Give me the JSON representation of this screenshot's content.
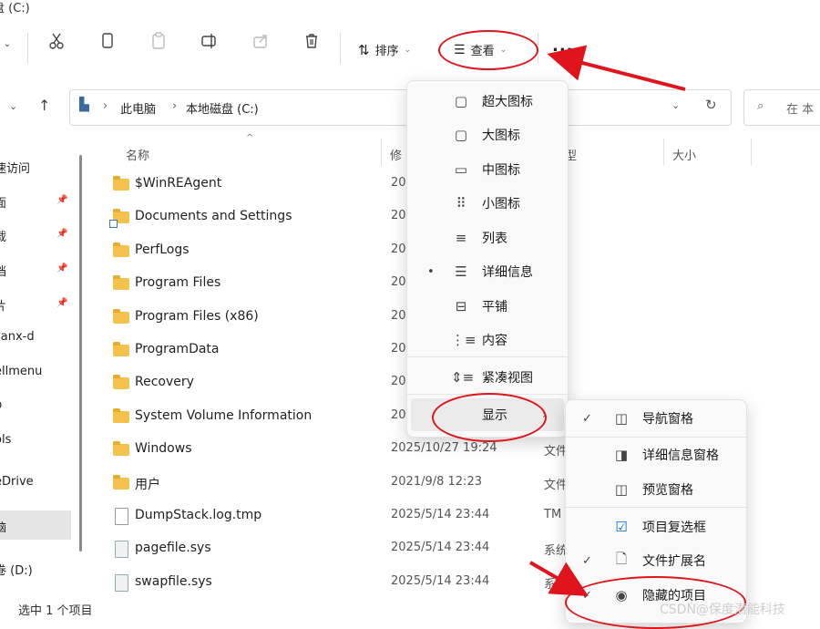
{
  "window": {
    "title": "盘 (C:)"
  },
  "toolbar": {
    "sort_label": "排序",
    "view_label": "查看",
    "more_label": "..."
  },
  "address": {
    "crumbs": [
      "此电脑",
      "本地磁盘 (C:)"
    ],
    "search_placeholder": "在 本"
  },
  "nav": {
    "items": [
      "速访问",
      "面",
      "载",
      "档",
      "片",
      "sanx-d",
      "ellmenu",
      "p",
      "ols",
      "eDrive",
      "脑",
      "卷 (D:)"
    ]
  },
  "columns": {
    "name": "名称",
    "date": "修",
    "type": "型",
    "size": "大小"
  },
  "files": [
    {
      "name": "$WinREAgent",
      "date": "20",
      "type": "夹",
      "icon": "folder"
    },
    {
      "name": "Documents and Settings",
      "date": "20",
      "type": "夹",
      "icon": "folder-shortcut"
    },
    {
      "name": "PerfLogs",
      "date": "20",
      "type": "夹",
      "icon": "folder"
    },
    {
      "name": "Program Files",
      "date": "20",
      "type": "夹",
      "icon": "folder"
    },
    {
      "name": "Program Files (x86)",
      "date": "20",
      "type": "夹",
      "icon": "folder"
    },
    {
      "name": "ProgramData",
      "date": "20",
      "type": "夹",
      "icon": "folder"
    },
    {
      "name": "Recovery",
      "date": "20",
      "type": "夹",
      "icon": "folder"
    },
    {
      "name": "System Volume Information",
      "date": "20",
      "type": "",
      "icon": "folder"
    },
    {
      "name": "Windows",
      "date": "2025/10/27 19:24",
      "type": "文件",
      "icon": "folder"
    },
    {
      "name": "用户",
      "date": "2021/9/8 12:23",
      "type": "文件",
      "icon": "folder"
    },
    {
      "name": "DumpStack.log.tmp",
      "date": "2025/5/14 23:44",
      "type": "TM",
      "icon": "file"
    },
    {
      "name": "pagefile.sys",
      "date": "2025/5/14 23:44",
      "type": "系统",
      "icon": "sys"
    },
    {
      "name": "swapfile.sys",
      "date": "2025/5/14 23:44",
      "type": "系",
      "icon": "sys"
    }
  ],
  "view_menu": {
    "items": [
      {
        "label": "超大图标",
        "icon": "monitor-icon"
      },
      {
        "label": "大图标",
        "icon": "monitor-icon"
      },
      {
        "label": "中图标",
        "icon": "monitor-small-icon"
      },
      {
        "label": "小图标",
        "icon": "grid-icon"
      },
      {
        "label": "列表",
        "icon": "list-icon"
      },
      {
        "label": "详细信息",
        "icon": "details-icon",
        "selected": true
      },
      {
        "label": "平铺",
        "icon": "tiles-icon"
      },
      {
        "label": "内容",
        "icon": "content-icon"
      },
      {
        "label": "紧凑视图",
        "icon": "compact-icon"
      },
      {
        "label": "显示",
        "icon": "",
        "submenu": true
      }
    ]
  },
  "show_submenu": {
    "items": [
      {
        "label": "导航窗格",
        "checked": true
      },
      {
        "label": "详细信息窗格",
        "checked": false
      },
      {
        "label": "预览窗格",
        "checked": false
      },
      {
        "label": "项目复选框",
        "checked": false
      },
      {
        "label": "文件扩展名",
        "checked": true
      },
      {
        "label": "隐藏的项目",
        "checked": true
      }
    ]
  },
  "status": {
    "text": "选中 1 个项目"
  },
  "watermark": "CSDN@保度潜能科技",
  "colors": {
    "accent": "#0067c0",
    "annotation": "#e0141c",
    "folder": "#f3c24c"
  }
}
